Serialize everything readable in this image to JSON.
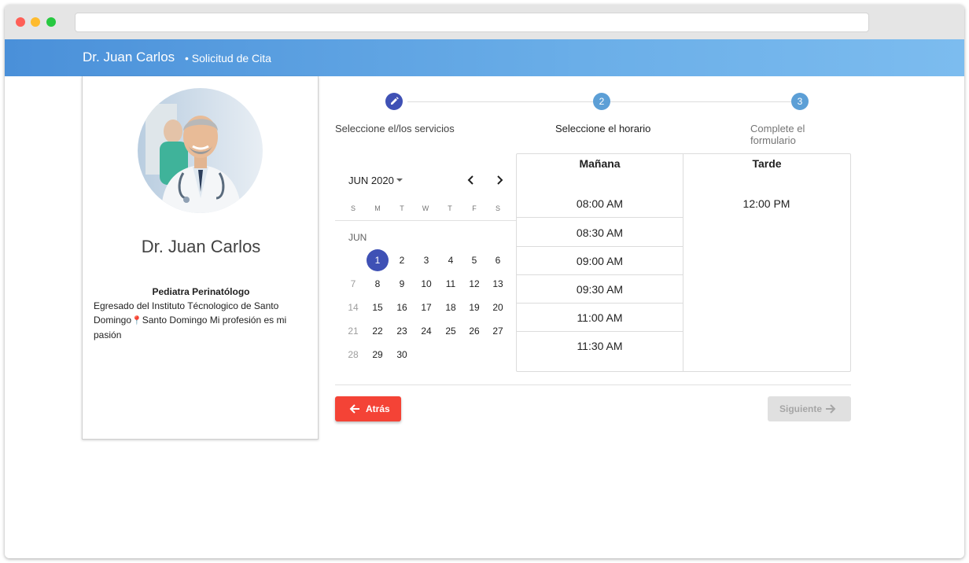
{
  "window": {
    "controls": [
      "close",
      "minimize",
      "maximize"
    ]
  },
  "header": {
    "doctor_name": "Dr. Juan Carlos",
    "subtitle": "• Solicitud de Cita"
  },
  "profile": {
    "name": "Dr. Juan Carlos",
    "specialty": "Pediatra Perinatólogo",
    "bio_part1": "Egresado del Instituto Técnologico de Santo Domingo",
    "pin_icon": "📍",
    "bio_part2": "Santo Domingo Mi profesión es mi pasión"
  },
  "stepper": {
    "steps": [
      {
        "number": "1",
        "label": "Seleccione el/los servicios",
        "state": "editing",
        "icon": "pencil-icon"
      },
      {
        "number": "2",
        "label": "Seleccione el horario",
        "state": "current"
      },
      {
        "number": "3",
        "label": "Complete el formulario",
        "state": "pending"
      }
    ],
    "colors": {
      "active": "#3f51b5",
      "pending": "#5c9fd6"
    }
  },
  "calendar": {
    "month_label": "JUN 2020",
    "weekdays": [
      "S",
      "M",
      "T",
      "W",
      "T",
      "F",
      "S"
    ],
    "month_short": "JUN",
    "selected_day": "1",
    "weeks": [
      [
        "",
        "1",
        "2",
        "3",
        "4",
        "5",
        "6"
      ],
      [
        "7",
        "8",
        "9",
        "10",
        "11",
        "12",
        "13"
      ],
      [
        "14",
        "15",
        "16",
        "17",
        "18",
        "19",
        "20"
      ],
      [
        "21",
        "22",
        "23",
        "24",
        "25",
        "26",
        "27"
      ],
      [
        "28",
        "29",
        "30",
        "",
        "",
        "",
        ""
      ]
    ],
    "disabled_days": [
      "7",
      "14",
      "21",
      "28"
    ]
  },
  "schedule": {
    "morning": {
      "title": "Mañana",
      "slots": [
        "08:00 AM",
        "08:30 AM",
        "09:00 AM",
        "09:30 AM",
        "11:00 AM",
        "11:30 AM"
      ]
    },
    "afternoon": {
      "title": "Tarde",
      "slots": [
        "12:00 PM"
      ]
    }
  },
  "actions": {
    "back_label": "Atrás",
    "next_label": "Siguiente",
    "back_color": "#f44336",
    "next_state": "disabled"
  }
}
